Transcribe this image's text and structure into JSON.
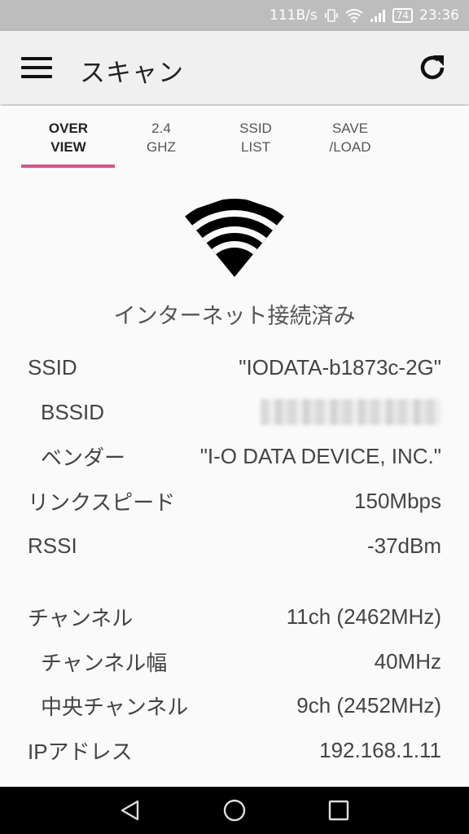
{
  "status_bar": {
    "network_speed": "111B/s",
    "battery": "74",
    "time": "23:36"
  },
  "toolbar": {
    "title": "スキャン"
  },
  "tabs": [
    {
      "label": "OVER\nVIEW",
      "active": true
    },
    {
      "label": "2.4\nGHZ",
      "active": false
    },
    {
      "label": "SSID\nLIST",
      "active": false
    },
    {
      "label": "SAVE\n/LOAD",
      "active": false
    }
  ],
  "accent_color": "#d9528a",
  "connection_status": "インターネット接続済み",
  "info": {
    "ssid": {
      "label": "SSID",
      "value": "\"IODATA-b1873c-2G\""
    },
    "bssid": {
      "label": "BSSID"
    },
    "vendor": {
      "label": "ベンダー",
      "value": "\"I-O DATA DEVICE, INC.\""
    },
    "link_speed": {
      "label": "リンクスピード",
      "value": "150Mbps"
    },
    "rssi": {
      "label": "RSSI",
      "value": "-37dBm"
    },
    "channel": {
      "label": "チャンネル",
      "value": "11ch (2462MHz)"
    },
    "channel_width": {
      "label": "チャンネル幅",
      "value": "40MHz"
    },
    "center_channel": {
      "label": "中央チャンネル",
      "value": "9ch (2452MHz)"
    },
    "ip_address": {
      "label": "IPアドレス",
      "value": "192.168.1.11"
    }
  },
  "icons": {
    "menu": "hamburger-menu-icon",
    "refresh": "refresh-icon",
    "wifi": "wifi-signal-icon",
    "back": "back-triangle-icon",
    "home": "home-circle-icon",
    "recents": "recents-square-icon"
  }
}
